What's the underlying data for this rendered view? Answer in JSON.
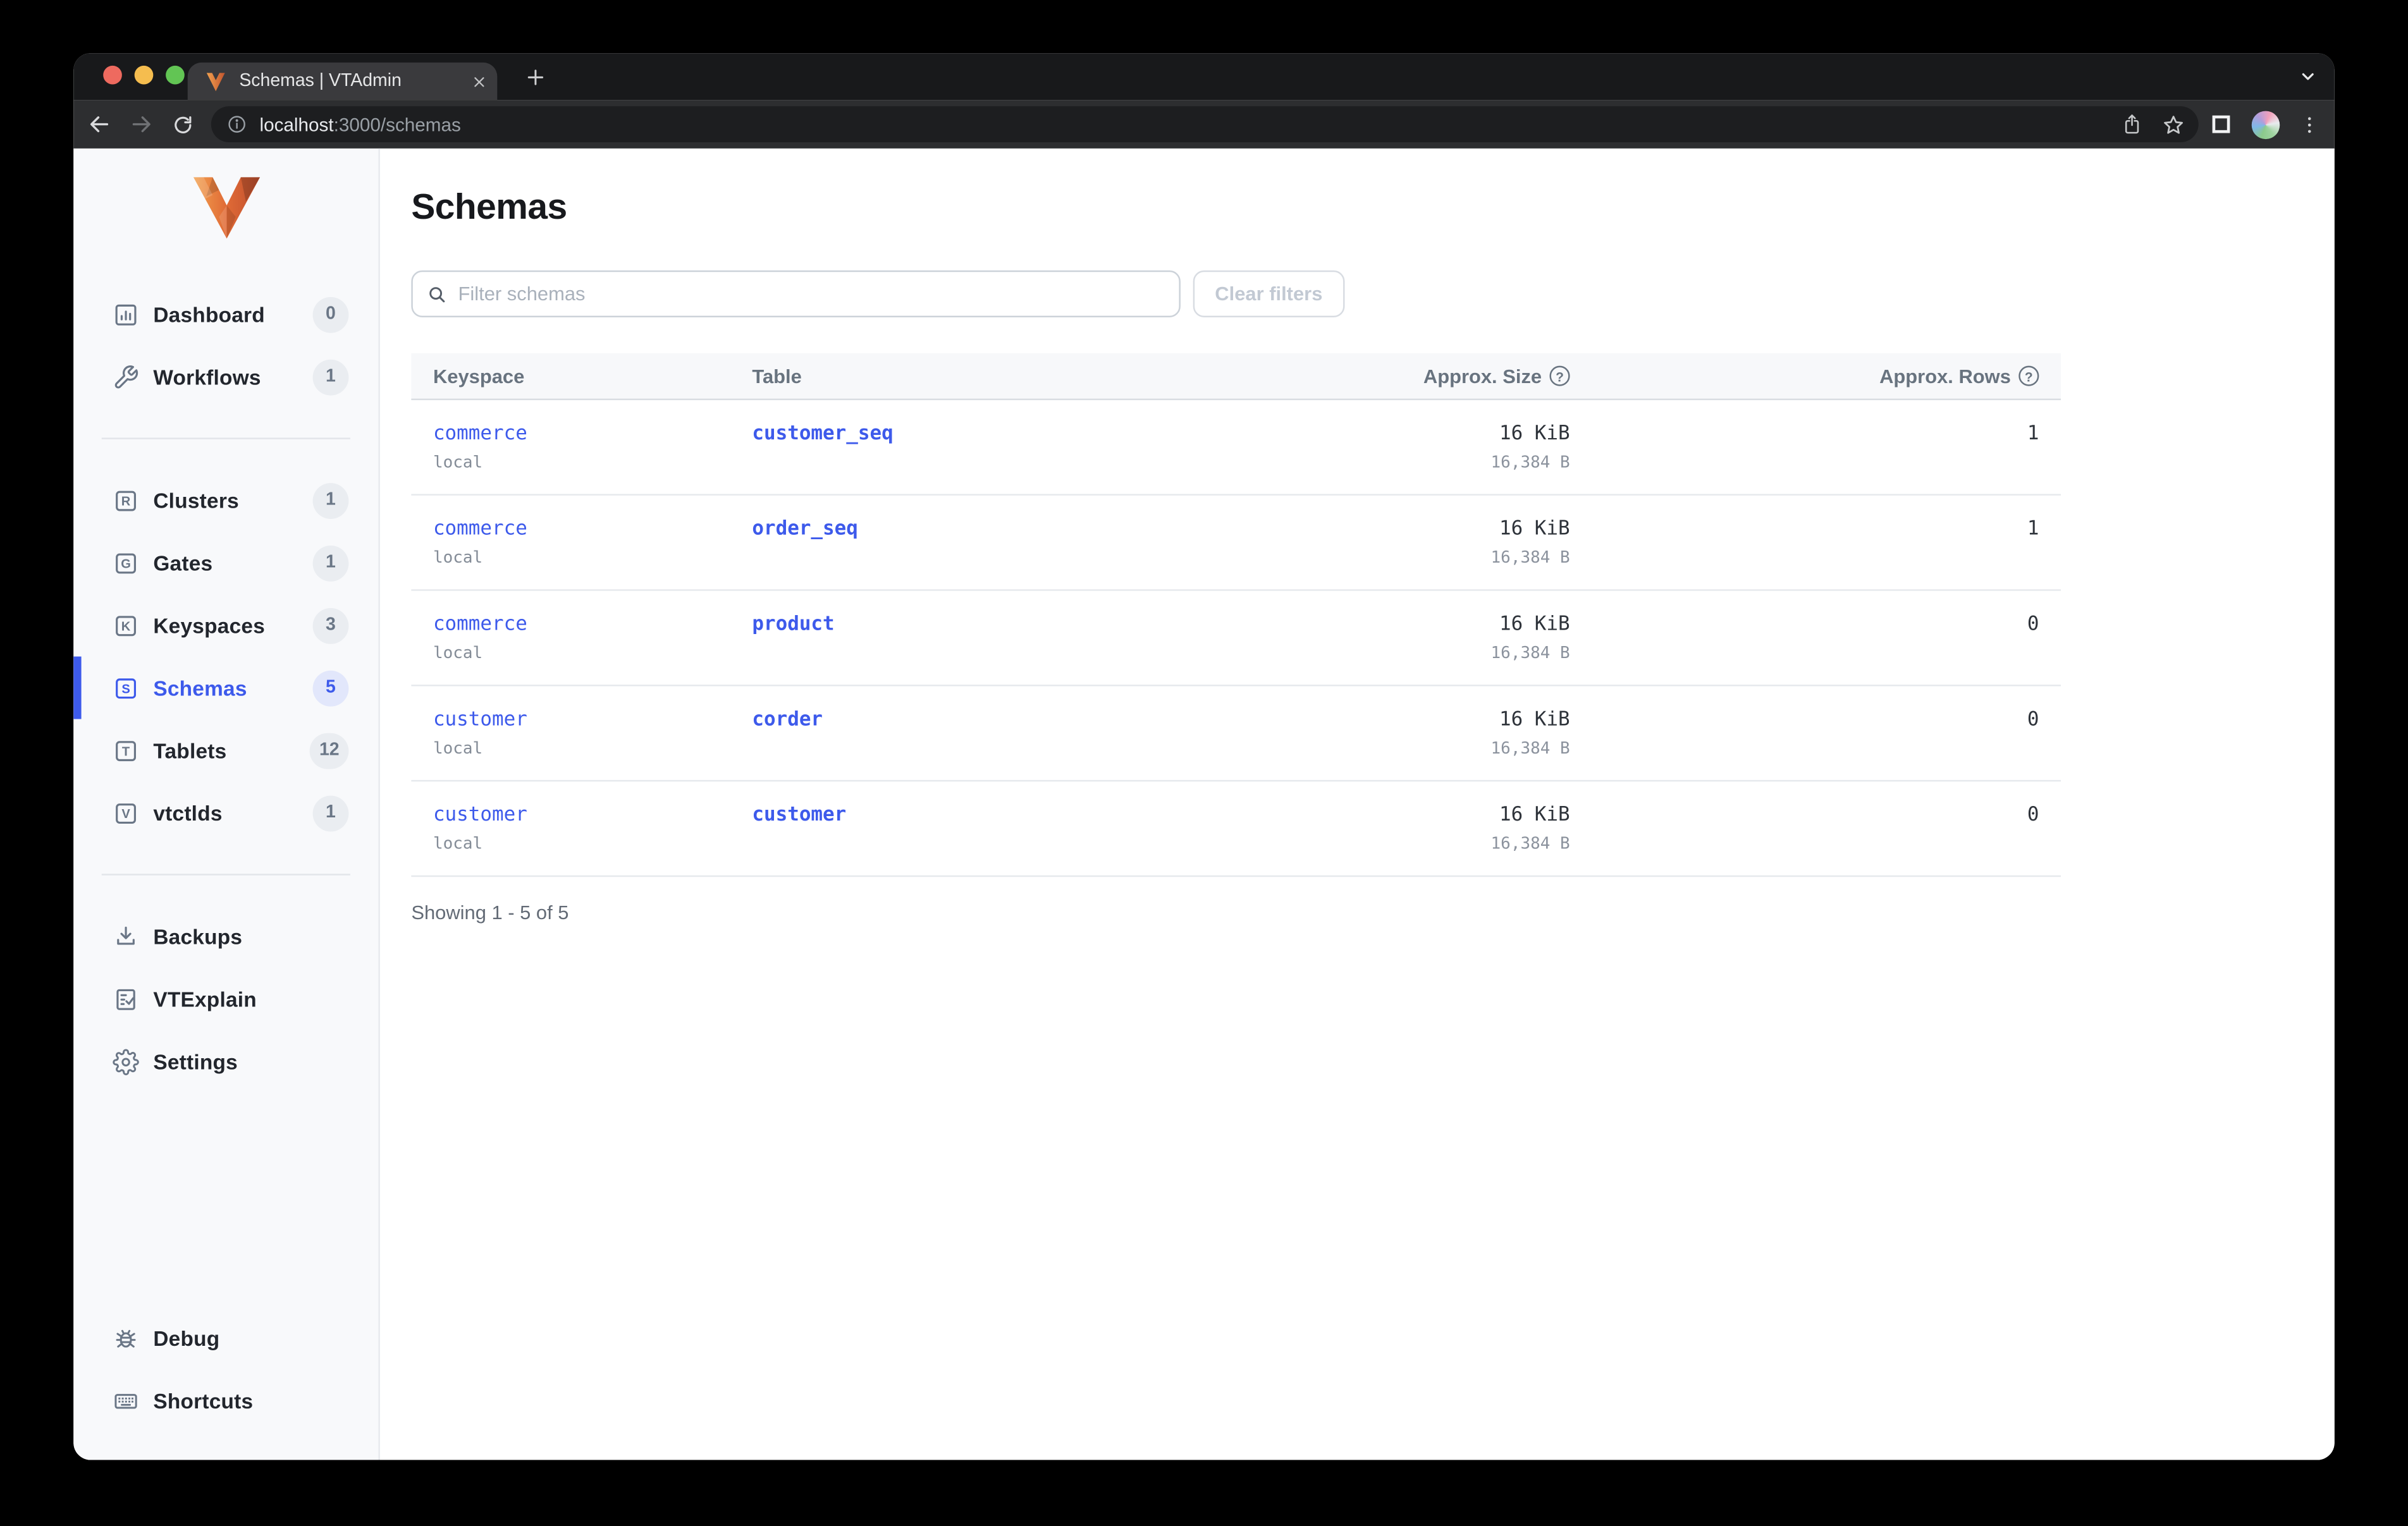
{
  "browser": {
    "tab_title": "Schemas | VTAdmin",
    "url_host": "localhost",
    "url_path": ":3000/schemas"
  },
  "sidebar": {
    "items": [
      {
        "label": "Dashboard",
        "count": "0"
      },
      {
        "label": "Workflows",
        "count": "1"
      },
      {
        "label": "Clusters",
        "count": "1",
        "letter": "R"
      },
      {
        "label": "Gates",
        "count": "1",
        "letter": "G"
      },
      {
        "label": "Keyspaces",
        "count": "3",
        "letter": "K"
      },
      {
        "label": "Schemas",
        "count": "5",
        "letter": "S"
      },
      {
        "label": "Tablets",
        "count": "12",
        "letter": "T"
      },
      {
        "label": "vtctlds",
        "count": "1",
        "letter": "V"
      },
      {
        "label": "Backups"
      },
      {
        "label": "VTExplain"
      },
      {
        "label": "Settings"
      },
      {
        "label": "Debug"
      },
      {
        "label": "Shortcuts"
      }
    ]
  },
  "main": {
    "title": "Schemas",
    "filter_placeholder": "Filter schemas",
    "clear_filters_label": "Clear filters",
    "table": {
      "headers": {
        "keyspace": "Keyspace",
        "table": "Table",
        "size": "Approx. Size",
        "rows": "Approx. Rows"
      },
      "help_glyph": "?",
      "rows": [
        {
          "keyspace": "commerce",
          "cluster": "local",
          "table": "customer_seq",
          "size": "16 KiB",
          "size_bytes": "16,384 B",
          "rows": "1"
        },
        {
          "keyspace": "commerce",
          "cluster": "local",
          "table": "order_seq",
          "size": "16 KiB",
          "size_bytes": "16,384 B",
          "rows": "1"
        },
        {
          "keyspace": "commerce",
          "cluster": "local",
          "table": "product",
          "size": "16 KiB",
          "size_bytes": "16,384 B",
          "rows": "0"
        },
        {
          "keyspace": "customer",
          "cluster": "local",
          "table": "corder",
          "size": "16 KiB",
          "size_bytes": "16,384 B",
          "rows": "0"
        },
        {
          "keyspace": "customer",
          "cluster": "local",
          "table": "customer",
          "size": "16 KiB",
          "size_bytes": "16,384 B",
          "rows": "0"
        }
      ]
    },
    "footer": "Showing 1 - 5 of 5"
  },
  "colors": {
    "accent": "#3d5aeb",
    "link": "#3d5aeb",
    "sidebar_bg": "#f8f9fb",
    "chrome_dark": "#18191b",
    "toolbar": "#2d2e30"
  }
}
